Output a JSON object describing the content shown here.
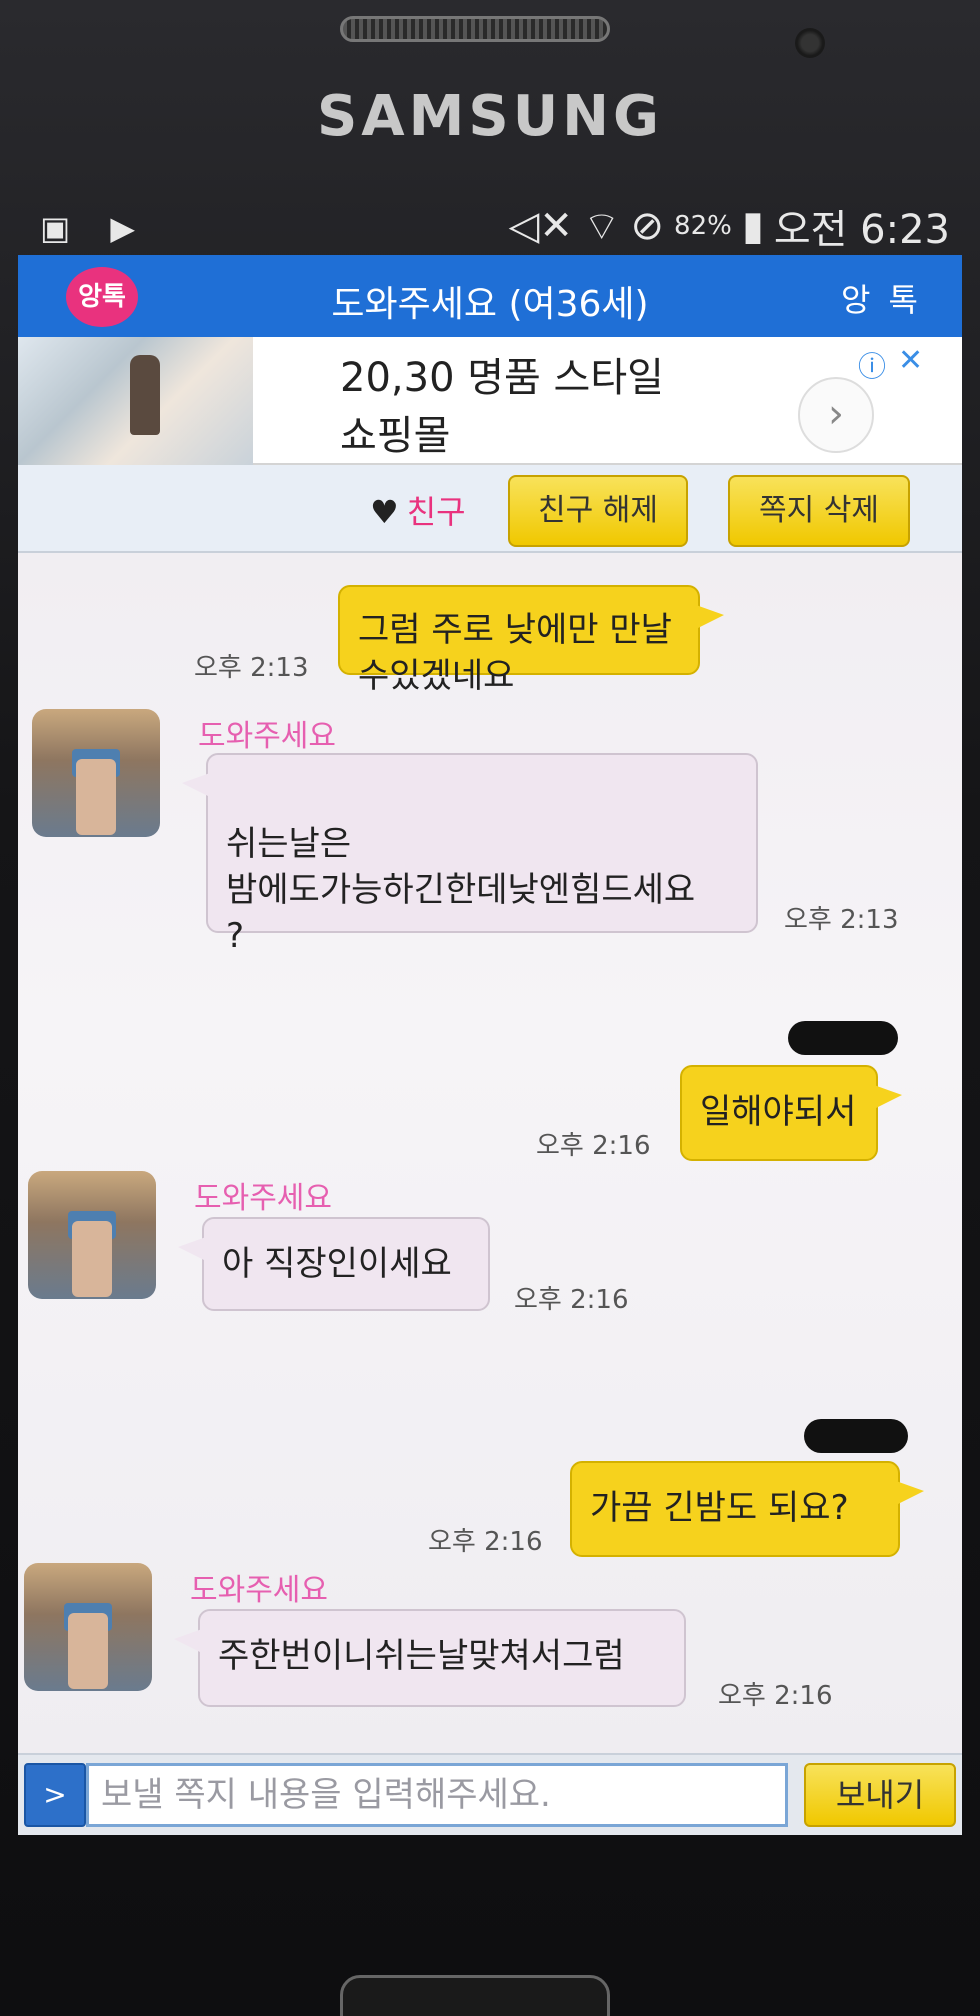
{
  "device": {
    "brand": "SAMSUNG"
  },
  "status_bar": {
    "battery": "82%",
    "time": "오전 6:23"
  },
  "app": {
    "logo_text": "앙톡",
    "title": "도와주세요 (여36세)",
    "right_label": "앙 톡"
  },
  "ad": {
    "line1": "20,30 명품 스타일",
    "line2": "쇼핑몰",
    "next_glyph": "›",
    "info_glyph": "ⓘ",
    "close_glyph": "✕"
  },
  "actions": {
    "friend_tag": "친구",
    "unfriend_label": "친구 해제",
    "delete_label": "쪽지 삭제"
  },
  "messages": [
    {
      "from": "me",
      "text": "그럼 주로 낮에만 만날수있겠네요",
      "time": "오후 2:13"
    },
    {
      "from": "them",
      "sender": "도와주세요",
      "text": "쉬는날은\n밤에도가능하긴한데낮엔힘드세요\n?",
      "time": "오후 2:13"
    },
    {
      "from": "me",
      "text": "일해야되서",
      "time": "오후 2:16"
    },
    {
      "from": "them",
      "sender": "도와주세요",
      "text": "아 직장인이세요",
      "time": "오후 2:16"
    },
    {
      "from": "me",
      "text": "가끔 긴밤도 되요?",
      "time": "오후 2:16"
    },
    {
      "from": "them",
      "sender": "도와주세요",
      "text": "주한번이니쉬는날맞쳐서그럼",
      "time": "오후 2:16"
    }
  ],
  "input": {
    "toggle_label": ">",
    "placeholder": "보낼 쪽지 내용을 입력해주세요.",
    "send_label": "보내기"
  },
  "colors": {
    "app_bar": "#1f6fd6",
    "my_bubble": "#f6d21d",
    "their_bubble": "#f0e6f0",
    "sender_name": "#e65fb0"
  }
}
